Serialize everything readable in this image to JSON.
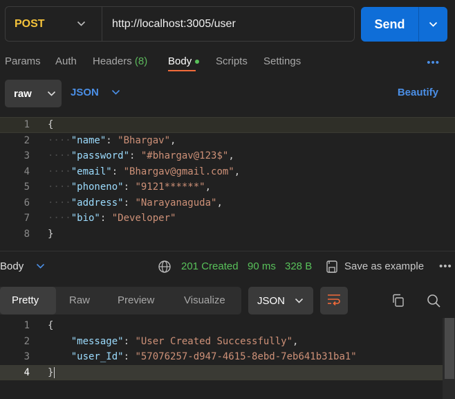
{
  "request": {
    "method": "POST",
    "url": "http://localhost:3005/user",
    "send_label": "Send"
  },
  "tabs": {
    "params": "Params",
    "auth": "Auth",
    "headers": "Headers",
    "headers_count": "(8)",
    "body": "Body",
    "scripts": "Scripts",
    "settings": "Settings",
    "more": "•••"
  },
  "body_options": {
    "mode": "raw",
    "language": "JSON",
    "beautify": "Beautify"
  },
  "request_body": {
    "line_numbers": [
      "1",
      "2",
      "3",
      "4",
      "5",
      "6",
      "7",
      "8"
    ],
    "open_brace": "{",
    "close_brace": "}",
    "fields": [
      {
        "key": "\"name\"",
        "value": "\"Bhargav\"",
        "trail": ","
      },
      {
        "key": "\"password\"",
        "value": "\"#bhargav@123$\"",
        "trail": ","
      },
      {
        "key": "\"email\"",
        "value": "\"Bhargav@gmail.com\"",
        "trail": ","
      },
      {
        "key": "\"phoneno\"",
        "value": "\"9121******\"",
        "trail": ","
      },
      {
        "key": "\"address\"",
        "value": "\"Narayanaguda\"",
        "trail": ","
      },
      {
        "key": "\"bio\"",
        "value": "\"Developer\"",
        "trail": ""
      }
    ]
  },
  "response": {
    "section_label": "Body",
    "status": "201 Created",
    "time": "90 ms",
    "size": "328 B",
    "save_label": "Save as example",
    "more": "•••",
    "view_tabs": {
      "pretty": "Pretty",
      "raw": "Raw",
      "preview": "Preview",
      "visualize": "Visualize"
    },
    "format": "JSON",
    "line_numbers": [
      "1",
      "2",
      "3",
      "4"
    ],
    "open_brace": "{",
    "close_brace": "}",
    "fields": [
      {
        "key": "\"message\"",
        "value": "\"User Created Successfully\"",
        "trail": ","
      },
      {
        "key": "\"user_Id\"",
        "value": "\"57076257-d947-4615-8ebd-7eb641b31ba1\"",
        "trail": ""
      }
    ]
  },
  "colors": {
    "method": "#f5c33b",
    "accent_blue": "#0f6ed8",
    "link_blue": "#4b8fe6",
    "success": "#58c15a",
    "active_tab_underline": "#f26b3a"
  },
  "icons": {
    "method_dropdown": "chevron-down-icon",
    "send_dropdown": "chevron-down-icon",
    "globe": "globe-icon",
    "save": "save-icon",
    "wrap": "wrap-lines-icon",
    "copy": "copy-icon",
    "search": "search-icon"
  }
}
